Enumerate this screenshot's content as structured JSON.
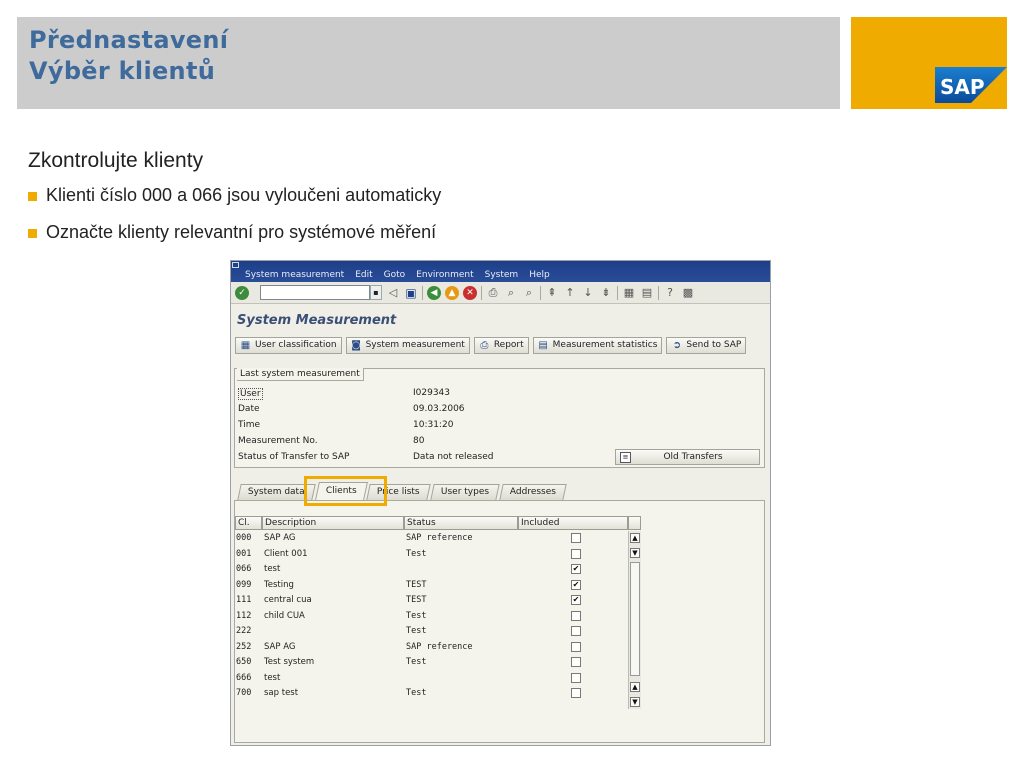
{
  "slide": {
    "title_line1": "Přednastavení",
    "title_line2": "Výběr klientů",
    "brand_logo_text": "SAP",
    "subtitle": "Zkontrolujte klienty",
    "bullets": [
      "Klienti číslo 000 a 066 jsou vyloučeni automaticky",
      "Označte klienty relevantní pro systémové měření"
    ],
    "colors": {
      "title_text": "#3f6a9c",
      "title_bar": "#cccccc",
      "accent": "#f0ab00"
    }
  },
  "sap": {
    "menu": [
      "System measurement",
      "Edit",
      "Goto",
      "Environment",
      "System",
      "Help"
    ],
    "toolbar_icons": [
      "enter-icon",
      "command-field",
      "back-icon",
      "save-icon",
      "back-green-icon",
      "exit-yellow-icon",
      "cancel-red-icon",
      "print-icon",
      "find-icon",
      "find-next-icon",
      "first-page-icon",
      "prev-page-icon",
      "next-page-icon",
      "last-page-icon",
      "create-session-icon",
      "shortcut-icon",
      "help-icon",
      "layout-icon"
    ],
    "screen_title": "System Measurement",
    "app_buttons": [
      {
        "label": "User classification",
        "icon": "table-icon"
      },
      {
        "label": "System measurement",
        "icon": "measure-icon"
      },
      {
        "label": "Report",
        "icon": "print-icon"
      },
      {
        "label": "Measurement statistics",
        "icon": "statistics-icon"
      },
      {
        "label": "Send to SAP",
        "icon": "send-icon"
      }
    ],
    "last_measurement": {
      "caption": "Last system measurement",
      "fields": [
        {
          "label": "User",
          "value": "I029343"
        },
        {
          "label": "Date",
          "value": "09.03.2006"
        },
        {
          "label": "Time",
          "value": "10:31:20"
        },
        {
          "label": "Measurement No.",
          "value": "80"
        },
        {
          "label": "Status of Transfer to SAP",
          "value": "Data not released"
        }
      ],
      "old_transfers_label": "Old Transfers"
    },
    "tabs": [
      "System data",
      "Clients",
      "Price lists",
      "User types",
      "Addresses"
    ],
    "active_tab": "Clients",
    "table": {
      "headers": [
        "Cl.",
        "Description",
        "Status",
        "Included"
      ],
      "rows": [
        {
          "cl": "000",
          "desc": "SAP AG",
          "status": "SAP reference",
          "included": false
        },
        {
          "cl": "001",
          "desc": "Client 001",
          "status": "Test",
          "included": false
        },
        {
          "cl": "066",
          "desc": "test",
          "status": "",
          "included": true
        },
        {
          "cl": "099",
          "desc": "Testing",
          "status": "TEST",
          "included": true
        },
        {
          "cl": "111",
          "desc": "central cua",
          "status": "TEST",
          "included": true
        },
        {
          "cl": "112",
          "desc": "child CUA",
          "status": "Test",
          "included": false
        },
        {
          "cl": "222",
          "desc": "",
          "status": "Test",
          "included": false
        },
        {
          "cl": "252",
          "desc": "SAP AG",
          "status": "SAP reference",
          "included": false
        },
        {
          "cl": "650",
          "desc": "Test system",
          "status": "Test",
          "included": false
        },
        {
          "cl": "666",
          "desc": "test",
          "status": "",
          "included": false
        },
        {
          "cl": "700",
          "desc": "sap test",
          "status": "Test",
          "included": false
        }
      ]
    }
  }
}
